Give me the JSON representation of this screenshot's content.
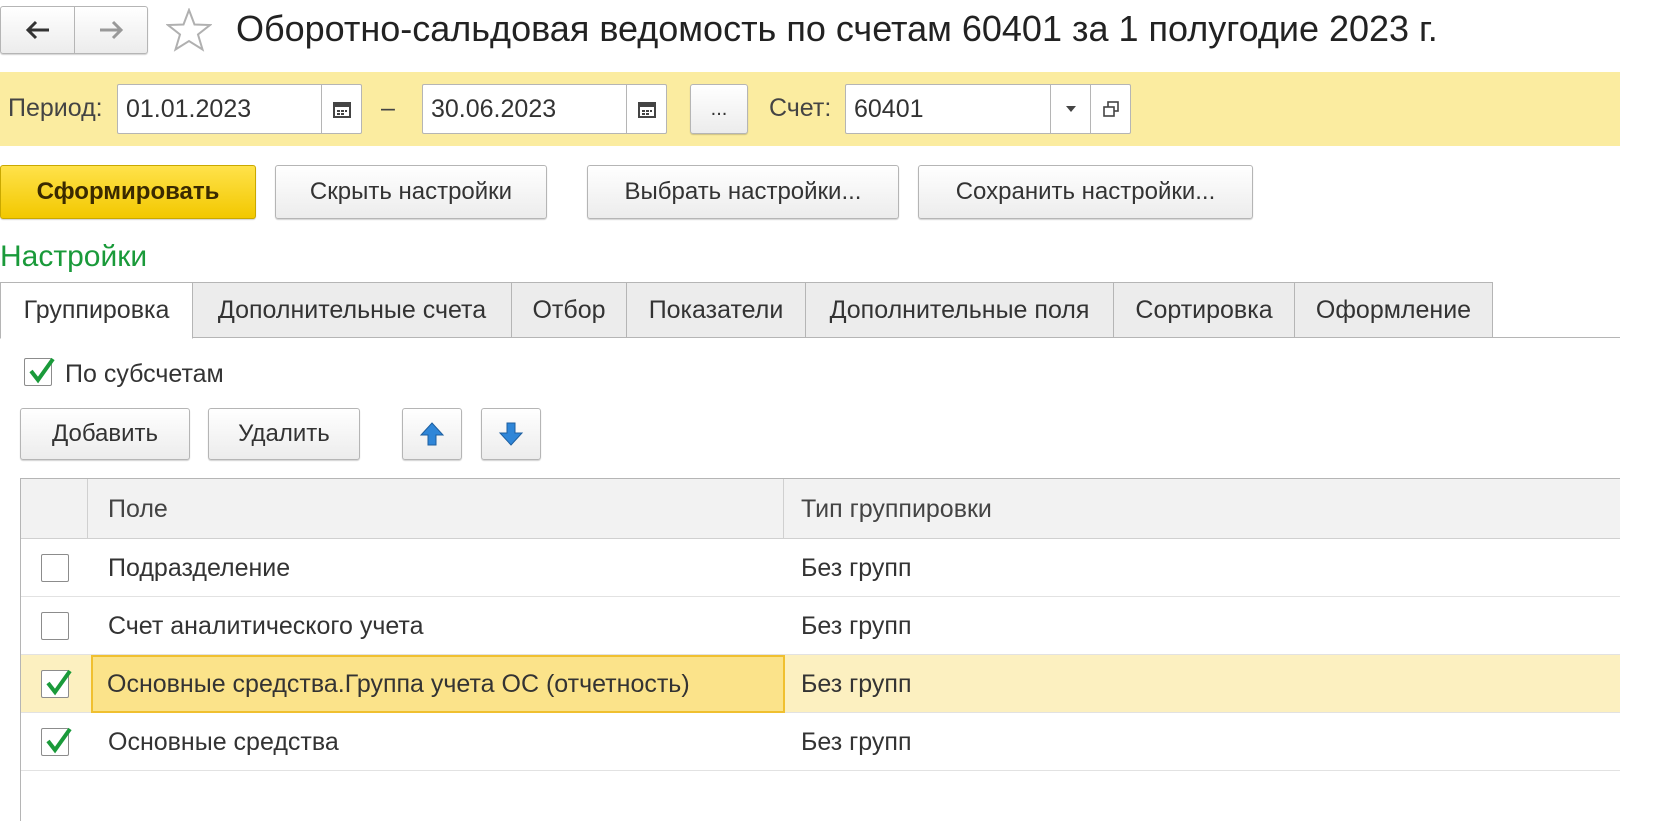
{
  "window": {
    "title": "Оборотно-сальдовая ведомость по счетам 60401 за 1 полугодие 2023 г."
  },
  "period": {
    "label": "Период:",
    "from": "01.01.2023",
    "dash": "–",
    "to": "30.06.2023",
    "more_label": "...",
    "account_label": "Счет:",
    "account_value": "60401"
  },
  "toolbar": {
    "generate_label": "Сформировать",
    "hide_settings_label": "Скрыть настройки",
    "choose_settings_label": "Выбрать настройки...",
    "save_settings_label": "Сохранить настройки..."
  },
  "settings": {
    "title": "Настройки",
    "tabs": [
      {
        "label": "Группировка",
        "active": true
      },
      {
        "label": "Дополнительные счета"
      },
      {
        "label": "Отбор"
      },
      {
        "label": "Показатели"
      },
      {
        "label": "Дополнительные поля"
      },
      {
        "label": "Сортировка"
      },
      {
        "label": "Оформление"
      }
    ],
    "by_subaccounts_label": "По субсчетам",
    "by_subaccounts_checked": true,
    "add_label": "Добавить",
    "delete_label": "Удалить"
  },
  "grid": {
    "columns": [
      "Поле",
      "Тип группировки"
    ],
    "rows": [
      {
        "field": "Подразделение",
        "type": "Без групп",
        "checked": false
      },
      {
        "field": "Счет аналитического учета",
        "type": "Без групп",
        "checked": false
      },
      {
        "field": "Основные средства.Группа учета ОС (отчетность)",
        "type": "Без групп",
        "checked": true,
        "selected": true
      },
      {
        "field": "Основные средства",
        "type": "Без групп",
        "checked": true
      }
    ]
  },
  "colors": {
    "accent_yellow": "#f5d000",
    "period_bar": "#fbeca0",
    "section_green": "#1a9a3a",
    "check_green": "#1a9a3a",
    "arrow_blue": "#2f86d8"
  }
}
